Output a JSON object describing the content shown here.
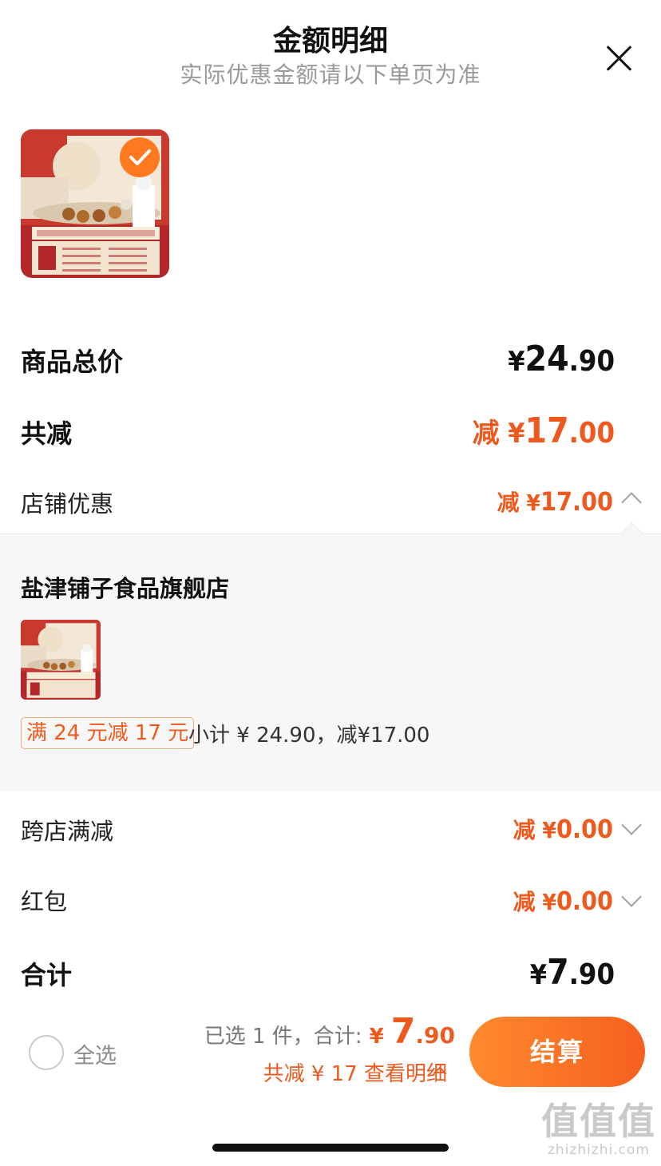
{
  "header": {
    "title": "金额明细",
    "subtitle": "实际优惠金额请以下单页为准"
  },
  "icons": {
    "close": "close-icon",
    "check": "checkmark-icon",
    "chevron_up": "chevron-up-icon",
    "chevron_down": "chevron-down-icon"
  },
  "summary": {
    "total_label": "商品总价",
    "total_yen": "¥",
    "total_int": "24",
    "total_dec": ".90",
    "discount_label": "共减",
    "discount_text": "减 ¥",
    "discount_int": "17",
    "discount_dec": ".00"
  },
  "store_discount": {
    "label": "店铺优惠",
    "text": "减 ¥",
    "int": "17",
    "dec": ".00",
    "expanded": true
  },
  "store_panel": {
    "shop_name": "盐津铺子食品旗舰店",
    "promo_tag": "满 24 元减 17 元",
    "subtotal": "小计 ¥ 24.90，减¥17.00"
  },
  "cross_store": {
    "label": "跨店满减",
    "text": "减 ¥",
    "int": "0",
    "dec": ".00"
  },
  "red_packet": {
    "label": "红包",
    "text": "减 ¥",
    "int": "0",
    "dec": ".00"
  },
  "grand_total": {
    "label": "合计",
    "yen": "¥",
    "int": "7",
    "dec": ".90"
  },
  "bottom_bar": {
    "select_all": "全选",
    "selected_text": "已选 1 件，合计:",
    "yen": " ¥ ",
    "price_int": "7",
    "price_dec": ".90",
    "detail_text": "共减 ¥ 17  查看明细",
    "checkout": "结算"
  },
  "watermark": {
    "cn": "值值值",
    "en": "zhizhizhi.com"
  },
  "colors": {
    "accent": "#ee5a1e",
    "checkout_start": "#ff8a2e",
    "checkout_end": "#f5601f"
  }
}
